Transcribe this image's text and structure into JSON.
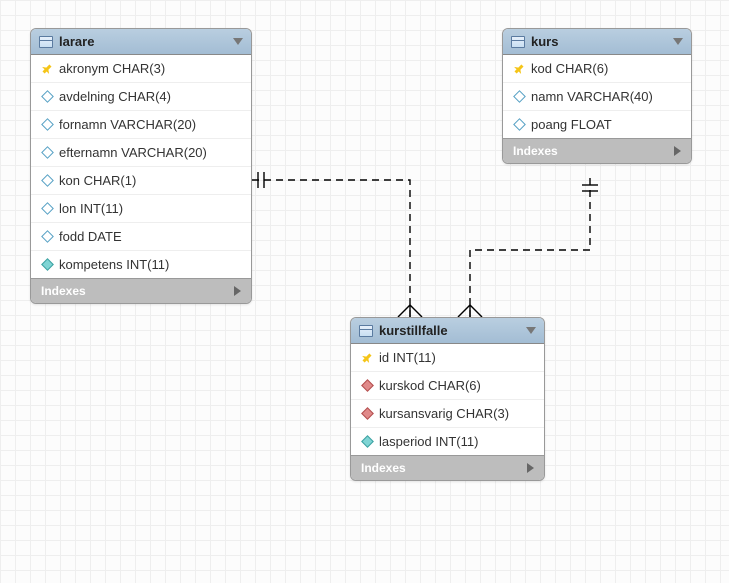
{
  "entities": {
    "larare": {
      "title": "larare",
      "indexes_label": "Indexes",
      "columns": [
        {
          "name": "akronym CHAR(3)",
          "icon": "key"
        },
        {
          "name": "avdelning CHAR(4)",
          "icon": "diamond"
        },
        {
          "name": "fornamn VARCHAR(20)",
          "icon": "diamond"
        },
        {
          "name": "efternamn VARCHAR(20)",
          "icon": "diamond"
        },
        {
          "name": "kon CHAR(1)",
          "icon": "diamond"
        },
        {
          "name": "lon INT(11)",
          "icon": "diamond"
        },
        {
          "name": "fodd DATE",
          "icon": "diamond"
        },
        {
          "name": "kompetens INT(11)",
          "icon": "cyan"
        }
      ]
    },
    "kurs": {
      "title": "kurs",
      "indexes_label": "Indexes",
      "columns": [
        {
          "name": "kod CHAR(6)",
          "icon": "key"
        },
        {
          "name": "namn VARCHAR(40)",
          "icon": "diamond"
        },
        {
          "name": "poang FLOAT",
          "icon": "diamond"
        }
      ]
    },
    "kurstillfalle": {
      "title": "kurstillfalle",
      "indexes_label": "Indexes",
      "columns": [
        {
          "name": "id INT(11)",
          "icon": "key"
        },
        {
          "name": "kurskod CHAR(6)",
          "icon": "red"
        },
        {
          "name": "kursansvarig CHAR(3)",
          "icon": "red"
        },
        {
          "name": "lasperiod INT(11)",
          "icon": "cyan"
        }
      ]
    }
  },
  "relationships": [
    {
      "from": "larare",
      "to": "kurstillfalle",
      "from_card": "one",
      "to_card": "many"
    },
    {
      "from": "kurs",
      "to": "kurstillfalle",
      "from_card": "one",
      "to_card": "many"
    }
  ]
}
